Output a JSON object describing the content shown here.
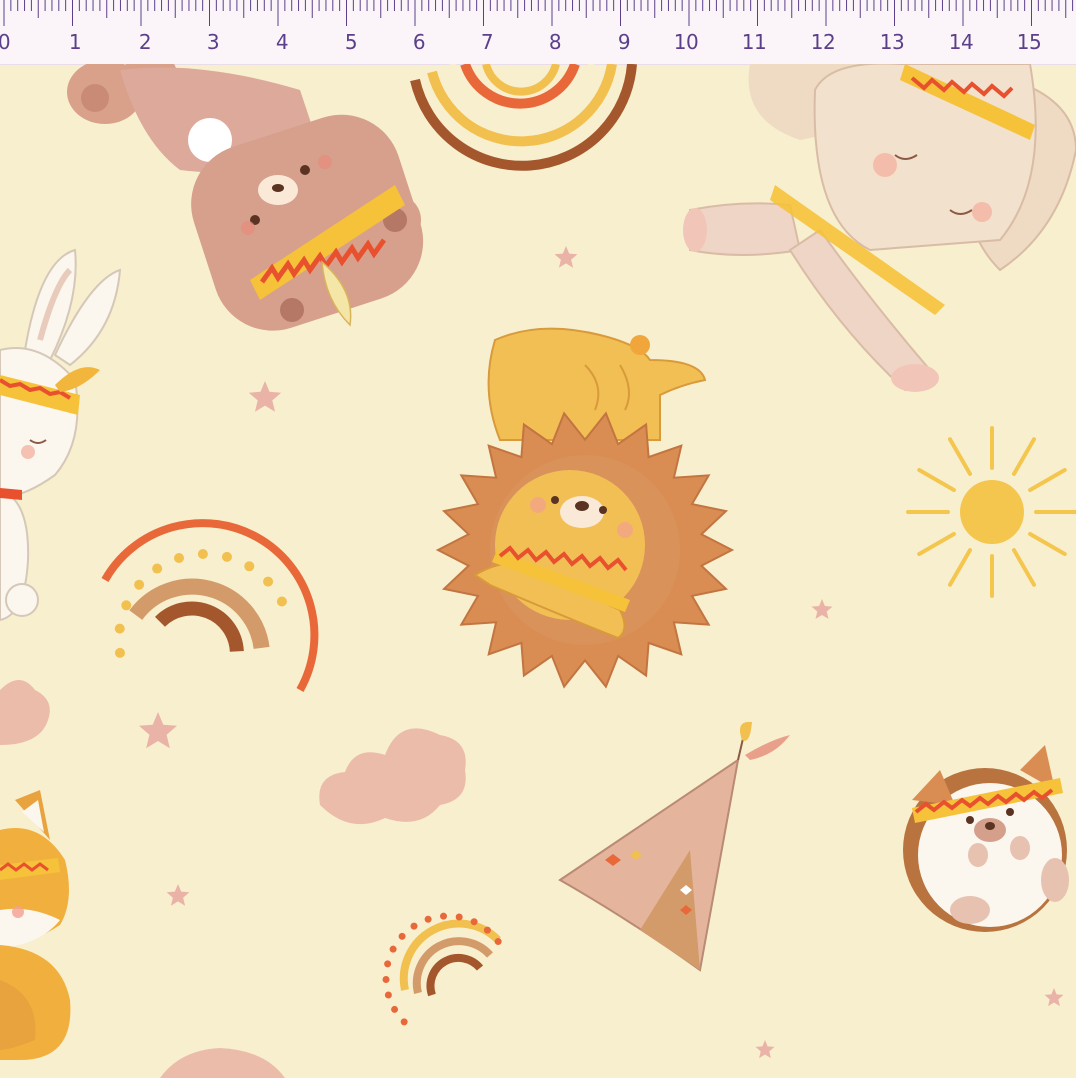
{
  "ruler": {
    "numbers": [
      "0",
      "1",
      "2",
      "3",
      "4",
      "5",
      "6",
      "7",
      "8",
      "9",
      "10",
      "11",
      "12",
      "13",
      "14",
      "15"
    ]
  },
  "colors": {
    "background": "#f8efcf",
    "ruler_background": "#fbf5f9",
    "ruler_ink": "#5b3f8a",
    "rainbow_orange": "#e8683a",
    "rainbow_yellow": "#f1c04e",
    "rainbow_tan": "#d49b6a",
    "rainbow_brown": "#a4572c",
    "headband_red": "#e8502e",
    "headband_yellow": "#f5c23a",
    "sun_yellow": "#f4c64e",
    "star_pink": "#e9b3a8",
    "cloud_pink": "#ecbcaa"
  },
  "illustrations": [
    "bear-icon",
    "rainbow-icon",
    "elephant-icon",
    "bunny-icon",
    "lion-icon",
    "sun-icon",
    "cloud-icon",
    "teepee-icon",
    "hedgehog-icon",
    "fox-icon",
    "star-icon"
  ]
}
